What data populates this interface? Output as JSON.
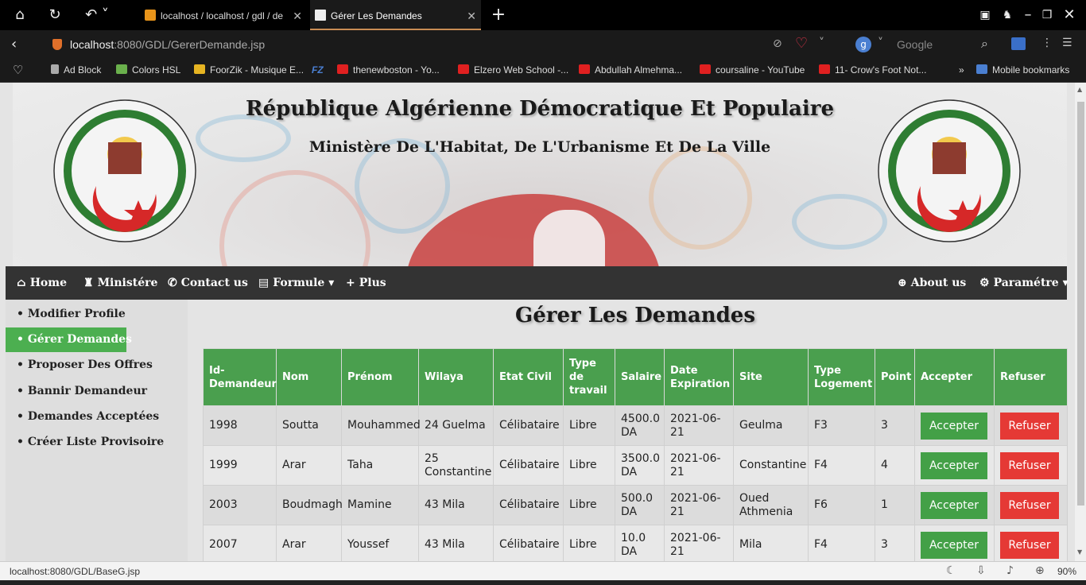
{
  "browser": {
    "tabs": [
      {
        "title": "localhost / localhost / gdl / de",
        "active": false
      },
      {
        "title": "Gérer Les Demandes",
        "active": true
      }
    ],
    "url_host": "localhost",
    "url_rest": ":8080/GDL/GererDemande.jsp",
    "search_engine": "Google",
    "bookmarks": [
      {
        "label": "Ad Block",
        "color": "#aaaaaa"
      },
      {
        "label": "Colors HSL",
        "color": "#6ab04c"
      },
      {
        "label": "FoorZik - Musique E...",
        "color": "#e6b422"
      },
      {
        "label": "FZ",
        "color": "#4a7fd1"
      },
      {
        "label": "thenewboston - Yo...",
        "color": "#e02020"
      },
      {
        "label": "Elzero Web School -...",
        "color": "#e02020"
      },
      {
        "label": "Abdullah Almehma...",
        "color": "#e02020"
      },
      {
        "label": "coursaline - YouTube",
        "color": "#e02020"
      },
      {
        "label": "11- Crow's Foot Not...",
        "color": "#e02020"
      }
    ],
    "bookmarks_overflow": "»",
    "mobile_bookmarks": "Mobile bookmarks",
    "status_url": "localhost:8080/GDL/BaseG.jsp",
    "zoom": "90%"
  },
  "banner": {
    "title": "République Algérienne Démocratique Et Populaire",
    "subtitle": "Ministère De L'Habitat, De L'Urbanisme Et De La Ville"
  },
  "navbar": {
    "home": "Home",
    "ministere": "Ministére",
    "contact": "Contact us",
    "formule": "Formule",
    "plus": "Plus",
    "about": "About us",
    "parametre": "Paramétre"
  },
  "sidebar": {
    "items": [
      {
        "label": "• Modifier Profile"
      },
      {
        "label": "• Gérer Demandes"
      },
      {
        "label": "• Proposer Des Offres"
      },
      {
        "label": "• Bannir Demandeur"
      },
      {
        "label": "• Demandes Acceptées"
      },
      {
        "label": "• Créer Liste Provisoire"
      }
    ]
  },
  "main": {
    "heading": "Gérer Les Demandes",
    "columns": [
      "Id-Demandeur",
      "Nom",
      "Prénom",
      "Wilaya",
      "Etat Civil",
      "Type de travail",
      "Salaire",
      "Date Expiration",
      "Site",
      "Type Logement",
      "Point",
      "Accepter",
      "Refuser"
    ],
    "accept_label": "Accepter",
    "refuse_label": "Refuser",
    "rows": [
      {
        "id": "1998",
        "nom": "Soutta",
        "prenom": "Mouhammed",
        "wilaya": "24 Guelma",
        "etat": "Célibataire",
        "travail": "Libre",
        "salaire": "4500.0 DA",
        "date": "2021-06-21",
        "site": "Geulma",
        "logement": "F3",
        "point": "3"
      },
      {
        "id": "1999",
        "nom": "Arar",
        "prenom": "Taha",
        "wilaya": "25 Constantine",
        "etat": "Célibataire",
        "travail": "Libre",
        "salaire": "3500.0 DA",
        "date": "2021-06-21",
        "site": "Constantine",
        "logement": "F4",
        "point": "4"
      },
      {
        "id": "2003",
        "nom": "Boudmagh",
        "prenom": "Mamine",
        "wilaya": "43 Mila",
        "etat": "Célibataire",
        "travail": "Libre",
        "salaire": "500.0 DA",
        "date": "2021-06-21",
        "site": "Oued Athmenia",
        "logement": "F6",
        "point": "1"
      },
      {
        "id": "2007",
        "nom": "Arar",
        "prenom": "Youssef",
        "wilaya": "43 Mila",
        "etat": "Célibataire",
        "travail": "Libre",
        "salaire": "10.0 DA",
        "date": "2021-06-21",
        "site": "Mila",
        "logement": "F4",
        "point": "3"
      }
    ]
  },
  "colors": {
    "accent_green": "#4a9f4e",
    "refuse_red": "#e53935",
    "navbar": "#333333"
  }
}
